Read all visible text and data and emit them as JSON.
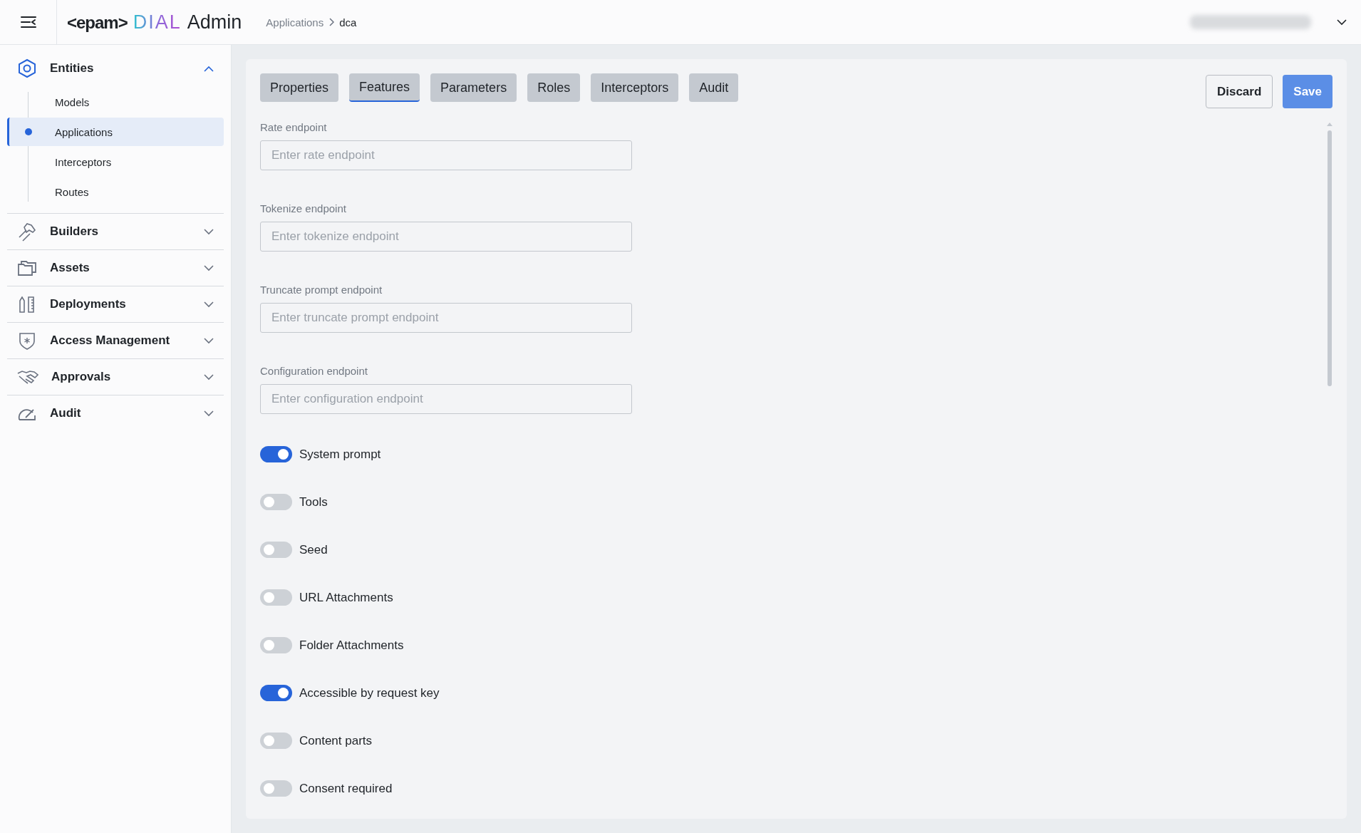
{
  "header": {
    "logo": {
      "brand": "<epam>",
      "product": "DIAL",
      "suffix": "Admin"
    },
    "breadcrumb": [
      {
        "label": "Applications"
      },
      {
        "label": "dca"
      }
    ]
  },
  "sidebar": {
    "sections": [
      {
        "label": "Entities",
        "expanded": true,
        "items": [
          {
            "label": "Models",
            "selected": false
          },
          {
            "label": "Applications",
            "selected": true
          },
          {
            "label": "Interceptors",
            "selected": false
          },
          {
            "label": "Routes",
            "selected": false
          }
        ]
      },
      {
        "label": "Builders",
        "expanded": false
      },
      {
        "label": "Assets",
        "expanded": false
      },
      {
        "label": "Deployments",
        "expanded": false
      },
      {
        "label": "Access Management",
        "expanded": false
      },
      {
        "label": "Approvals",
        "expanded": false
      },
      {
        "label": "Audit",
        "expanded": false
      }
    ]
  },
  "tabs": [
    {
      "label": "Properties",
      "selected": false
    },
    {
      "label": "Features",
      "selected": true
    },
    {
      "label": "Parameters",
      "selected": false
    },
    {
      "label": "Roles",
      "selected": false
    },
    {
      "label": "Interceptors",
      "selected": false
    },
    {
      "label": "Audit",
      "selected": false
    }
  ],
  "buttons": {
    "discard": "Discard",
    "save": "Save"
  },
  "fields": [
    {
      "label": "Rate endpoint",
      "placeholder": "Enter rate endpoint"
    },
    {
      "label": "Tokenize endpoint",
      "placeholder": "Enter tokenize endpoint"
    },
    {
      "label": "Truncate prompt endpoint",
      "placeholder": "Enter truncate prompt endpoint"
    },
    {
      "label": "Configuration endpoint",
      "placeholder": "Enter configuration endpoint"
    }
  ],
  "toggles": [
    {
      "label": "System prompt",
      "on": true
    },
    {
      "label": "Tools",
      "on": false
    },
    {
      "label": "Seed",
      "on": false
    },
    {
      "label": "URL Attachments",
      "on": false
    },
    {
      "label": "Folder Attachments",
      "on": false
    },
    {
      "label": "Accessible by request key",
      "on": true
    },
    {
      "label": "Content parts",
      "on": false
    },
    {
      "label": "Consent required",
      "on": false
    }
  ]
}
